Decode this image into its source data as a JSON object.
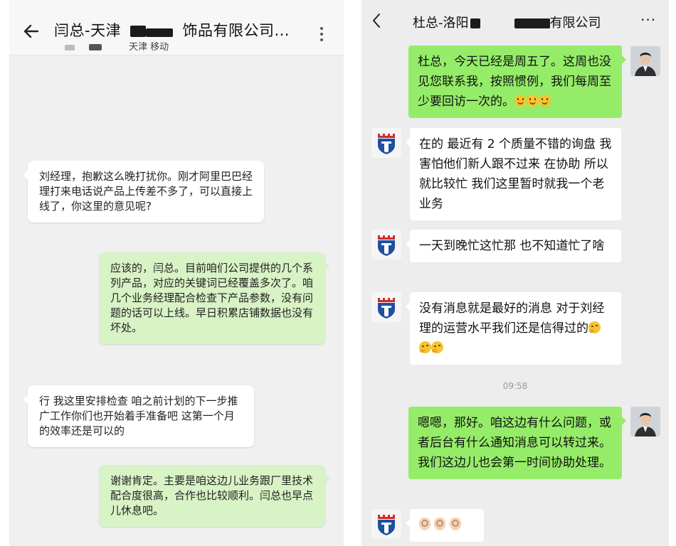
{
  "left_chat": {
    "title_prefix": "闫总-天津",
    "title_suffix": "饰品有限公司...",
    "subtitle": "天津 移动",
    "messages": [
      {
        "from": "them",
        "text": "刘经理，抱歉这么晚打扰你。刚才阿里巴巴经理打来电话说产品上传差不多了，可以直接上线了，你这里的意见呢?"
      },
      {
        "from": "me",
        "text": "应该的，闫总。目前咱们公司提供的几个系列产品，对应的关键词已经覆盖多次了。咱几个业务经理配合检查下产品参数，没有问题的话可以上线。早日积累店铺数据也没有坏处。"
      },
      {
        "from": "them",
        "text": "行 我这里安排检查 咱之前计划的下一步推广工作你们也开始着手准备吧 这第一个月的效率还是可以的"
      },
      {
        "from": "me",
        "text": "谢谢肯定。主要是咱这边儿业务跟厂里技术配合度很高，合作也比较顺利。闫总也早点儿休息吧。"
      }
    ]
  },
  "right_chat": {
    "title_prefix": "杜总-洛阳",
    "title_suffix": "有限公司",
    "more": "···",
    "timestamp": "09:58",
    "messages": [
      {
        "from": "me",
        "text": "杜总，今天已经是周五了。这周也没见您联系我，按照惯例，我们每周至少要回访一次的。"
      },
      {
        "from": "them",
        "text": "在的 最近有 2 个质量不错的询盘 我害怕他们新人跟不过来 在协助 所以就比较忙 我们这里暂时就我一个老业务"
      },
      {
        "from": "them",
        "text": "一天到晚忙这忙那 也不知道忙了啥"
      },
      {
        "from": "them",
        "text": "没有消息就是最好的消息 对于刘经理的运营水平我们还是信得过的"
      },
      {
        "from": "me",
        "text": "嗯嗯，那好。咱这边有什么问题，或者后台有什么通知消息可以转过来。我们这边儿也会第一时间协助处理。"
      },
      {
        "from": "them",
        "text": ""
      }
    ]
  },
  "colors": {
    "wechat_green": "#95ec69",
    "left_green": "#d8f3c5",
    "logo_red": "#d12b2b",
    "logo_blue": "#1f4fa0"
  }
}
